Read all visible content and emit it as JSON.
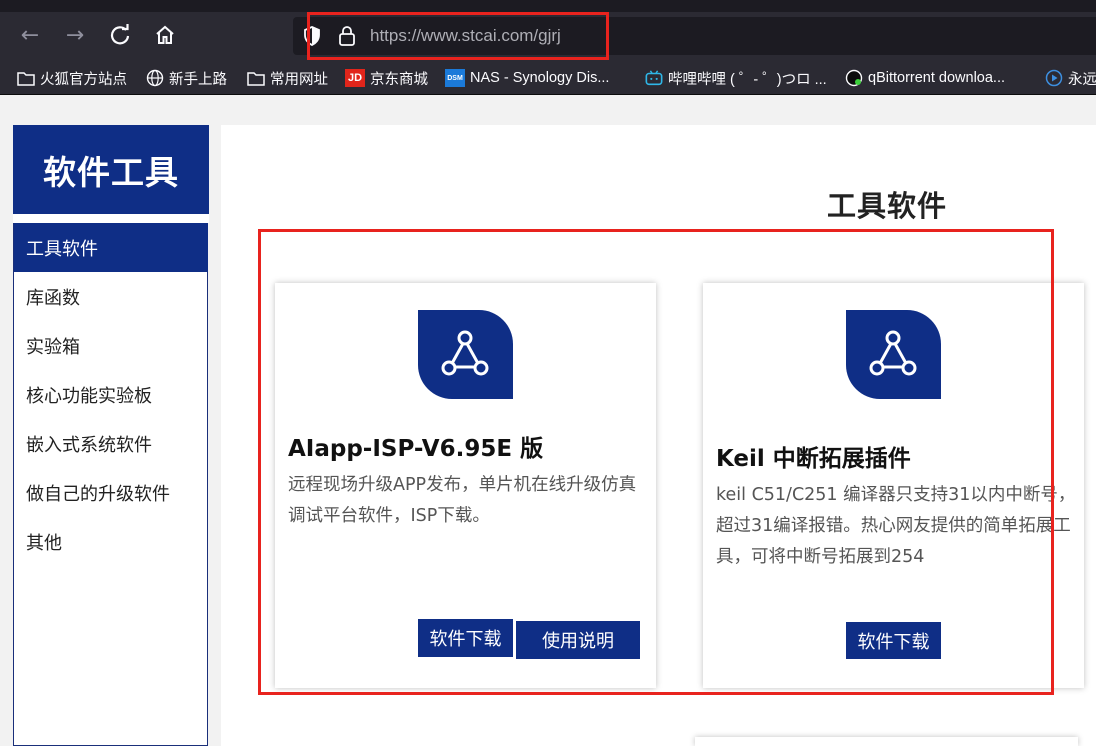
{
  "browser": {
    "url": "https://www.stcai.com/gjrj",
    "bookmarks": [
      {
        "label": "火狐官方站点",
        "icon": "folder-icon"
      },
      {
        "label": "新手上路",
        "icon": "globe-icon"
      },
      {
        "label": "常用网址",
        "icon": "folder-icon"
      },
      {
        "label": "京东商城",
        "icon": "jd-icon"
      },
      {
        "label": "NAS - Synology Dis...",
        "icon": "dsm-icon"
      },
      {
        "label": "哔哩哔哩 ( ゜- ゜)つロ ...",
        "icon": "bilibili-icon"
      },
      {
        "label": "qBittorrent downloa...",
        "icon": "qbittorrent-icon"
      },
      {
        "label": "永远",
        "icon": "play-icon"
      }
    ],
    "jd_icon_text": "JD",
    "dsm_icon_text": "DSM"
  },
  "sidebar": {
    "title": "软件工具",
    "items": [
      {
        "label": "工具软件",
        "active": true
      },
      {
        "label": "库函数"
      },
      {
        "label": "实验箱"
      },
      {
        "label": "核心功能实验板"
      },
      {
        "label": "嵌入式系统软件"
      },
      {
        "label": "做自己的升级软件"
      },
      {
        "label": "其他"
      }
    ]
  },
  "main": {
    "title": "工具软件",
    "cards": [
      {
        "title": "AIapp-ISP-V6.95E 版",
        "description": "远程现场升级APP发布，单片机在线升级仿真调试平台软件，ISP下载。",
        "buttons": [
          "软件下载",
          "使用说明"
        ]
      },
      {
        "title": "Keil 中断拓展插件",
        "description": "keil C51/C251 编译器只支持31以内中断号，超过31编译报错。热心网友提供的简单拓展工具，可将中断号拓展到254",
        "buttons": [
          "软件下载"
        ]
      }
    ]
  },
  "colors": {
    "brand_blue": "#0f2e86",
    "highlight_red": "#e8231e",
    "browser_dark": "#2b2a33"
  }
}
